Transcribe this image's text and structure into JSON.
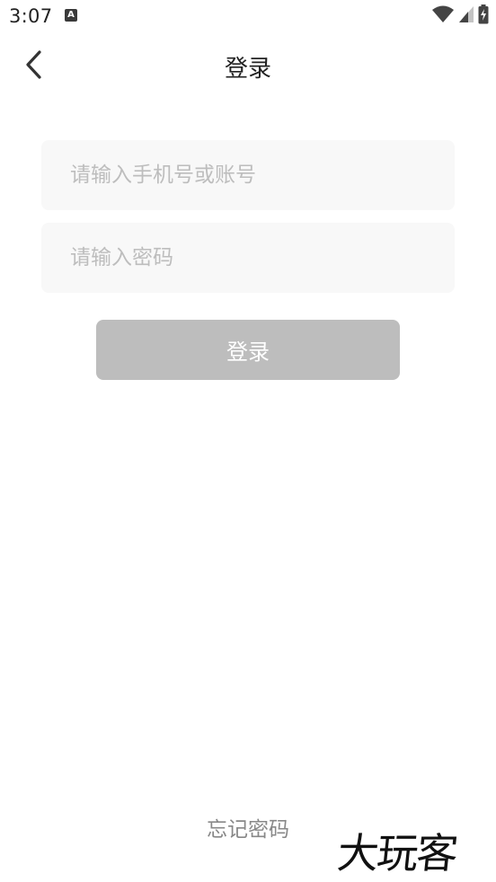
{
  "status_bar": {
    "time": "3:07",
    "notification_letter": "A",
    "icons": [
      "wifi-icon",
      "cell-signal-icon",
      "battery-charging-icon"
    ]
  },
  "header": {
    "title": "登录",
    "back_icon": "chevron-left-icon"
  },
  "form": {
    "account_placeholder": "请输入手机号或账号",
    "account_value": "",
    "password_placeholder": "请输入密码",
    "password_value": "",
    "login_label": "登录"
  },
  "footer": {
    "forgot_password": "忘记密码"
  },
  "watermark": {
    "text": "大玩客"
  },
  "colors": {
    "background": "#ffffff",
    "input_background": "#f8f8f8",
    "placeholder": "#bdbdbd",
    "button_disabled": "#bdbdbd",
    "title_text": "#222222",
    "link_text": "#888888"
  }
}
